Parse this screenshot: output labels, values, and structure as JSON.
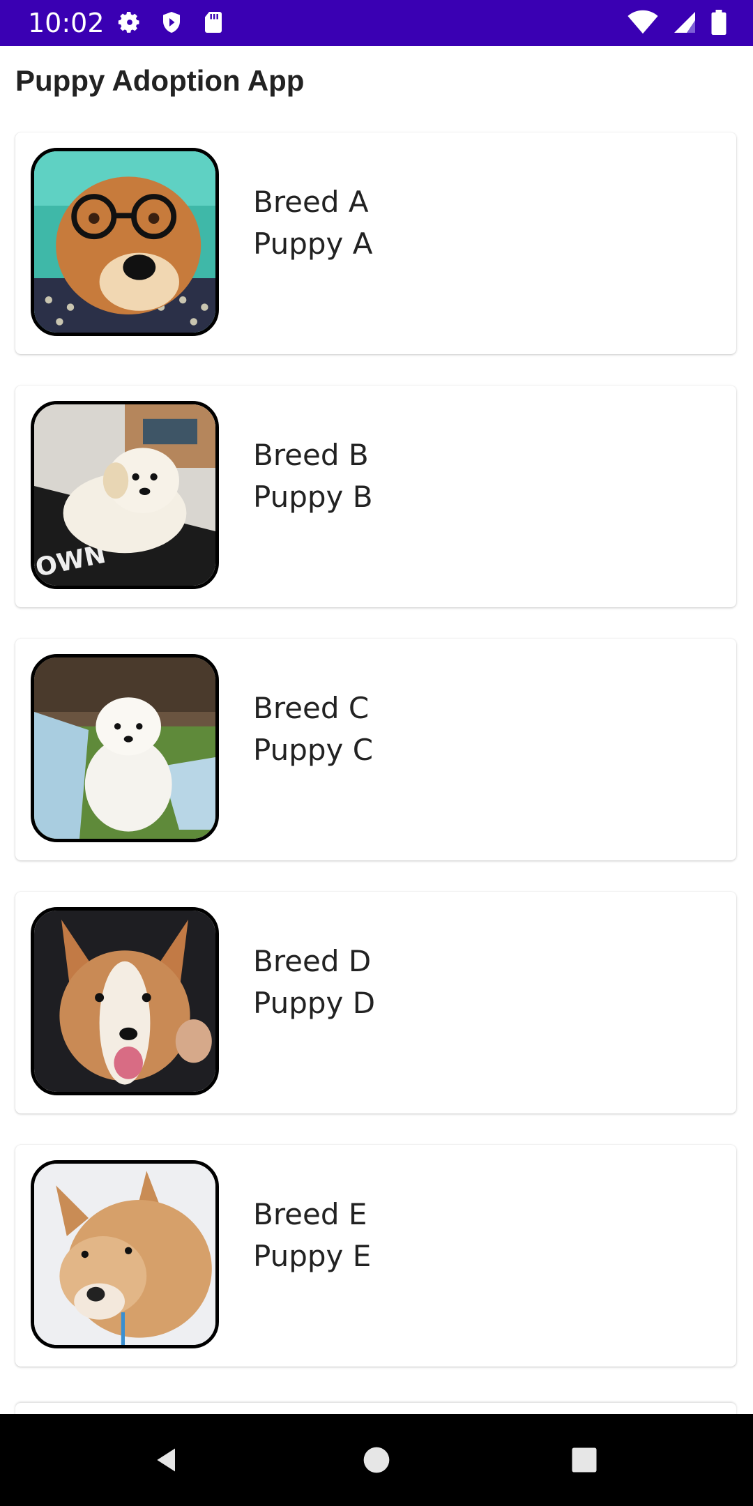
{
  "status_bar": {
    "time": "10:02",
    "left_icons": [
      "gear-icon",
      "shield-icon",
      "sd-card-icon"
    ],
    "right_icons": [
      "wifi-icon",
      "signal-icon",
      "battery-icon"
    ],
    "background": "#3a00b3"
  },
  "app": {
    "title": "Puppy Adoption App"
  },
  "puppies": [
    {
      "breed": "Breed A",
      "name": "Puppy A",
      "photo": "corgi-with-glasses-photo"
    },
    {
      "breed": "Breed B",
      "name": "Puppy B",
      "photo": "golden-retriever-puppy-photo"
    },
    {
      "breed": "Breed C",
      "name": "Puppy C",
      "photo": "white-fluffy-puppy-photo"
    },
    {
      "breed": "Breed D",
      "name": "Puppy D",
      "photo": "corgi-puppy-tongue-photo"
    },
    {
      "breed": "Breed E",
      "name": "Puppy E",
      "photo": "shiba-inu-snow-photo"
    }
  ],
  "nav_bar": {
    "buttons": [
      "back-icon",
      "home-icon",
      "recents-icon"
    ]
  }
}
